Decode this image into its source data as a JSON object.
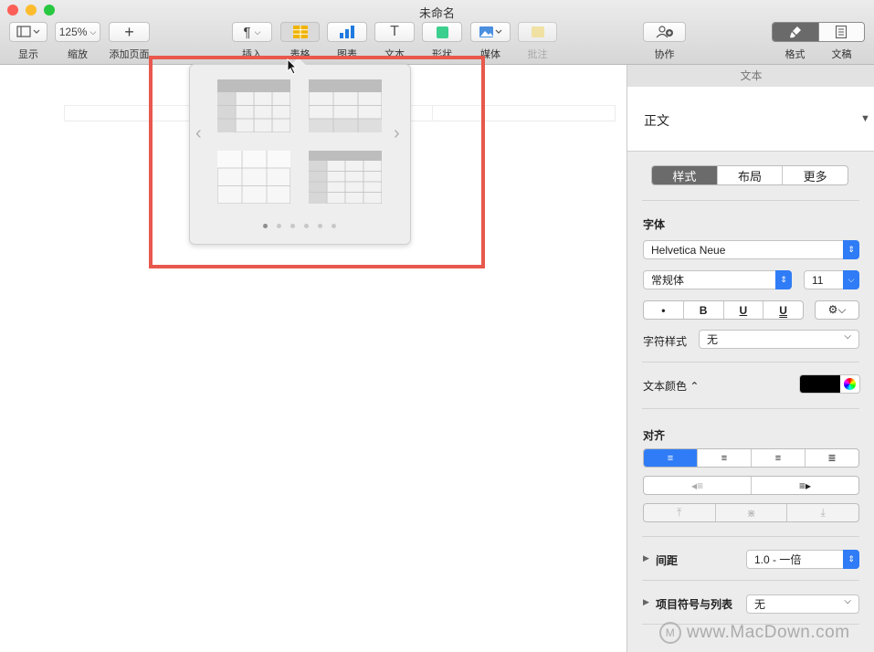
{
  "window": {
    "title": "未命名"
  },
  "toolbar": {
    "view_label": "显示",
    "zoom_value": "125%",
    "zoom_label": "缩放",
    "add_page_label": "添加页面",
    "insert_label": "插入",
    "table_label": "表格",
    "chart_label": "图表",
    "text_label": "文本",
    "shape_label": "形状",
    "media_label": "媒体",
    "comment_label": "批注",
    "collaborate_label": "协作",
    "format_label": "格式",
    "document_label": "文稿"
  },
  "table_popover": {
    "page_count": 6,
    "current_page": 1
  },
  "panel": {
    "header": "文本",
    "paragraph_style": "正文",
    "tabs": [
      "样式",
      "布局",
      "更多"
    ],
    "font_section": "字体",
    "font_family": "Helvetica Neue",
    "font_style": "常规体",
    "font_size": "11",
    "format_buttons": [
      "•",
      "B",
      "U",
      "U"
    ],
    "char_style_label": "字符样式",
    "char_style_value": "无",
    "text_color_label": "文本颜色 ⌃",
    "align_section": "对齐",
    "spacing_label": "间距",
    "spacing_value": "1.0 - 一倍",
    "bullets_label": "项目符号与列表",
    "bullets_value": "无"
  },
  "watermark": "www.MacDown.com",
  "colors": {
    "accent": "#2f7cf6",
    "highlight": "#e8584c",
    "table_icon": "#f0b400",
    "shape_icon": "#3ccf8e"
  }
}
